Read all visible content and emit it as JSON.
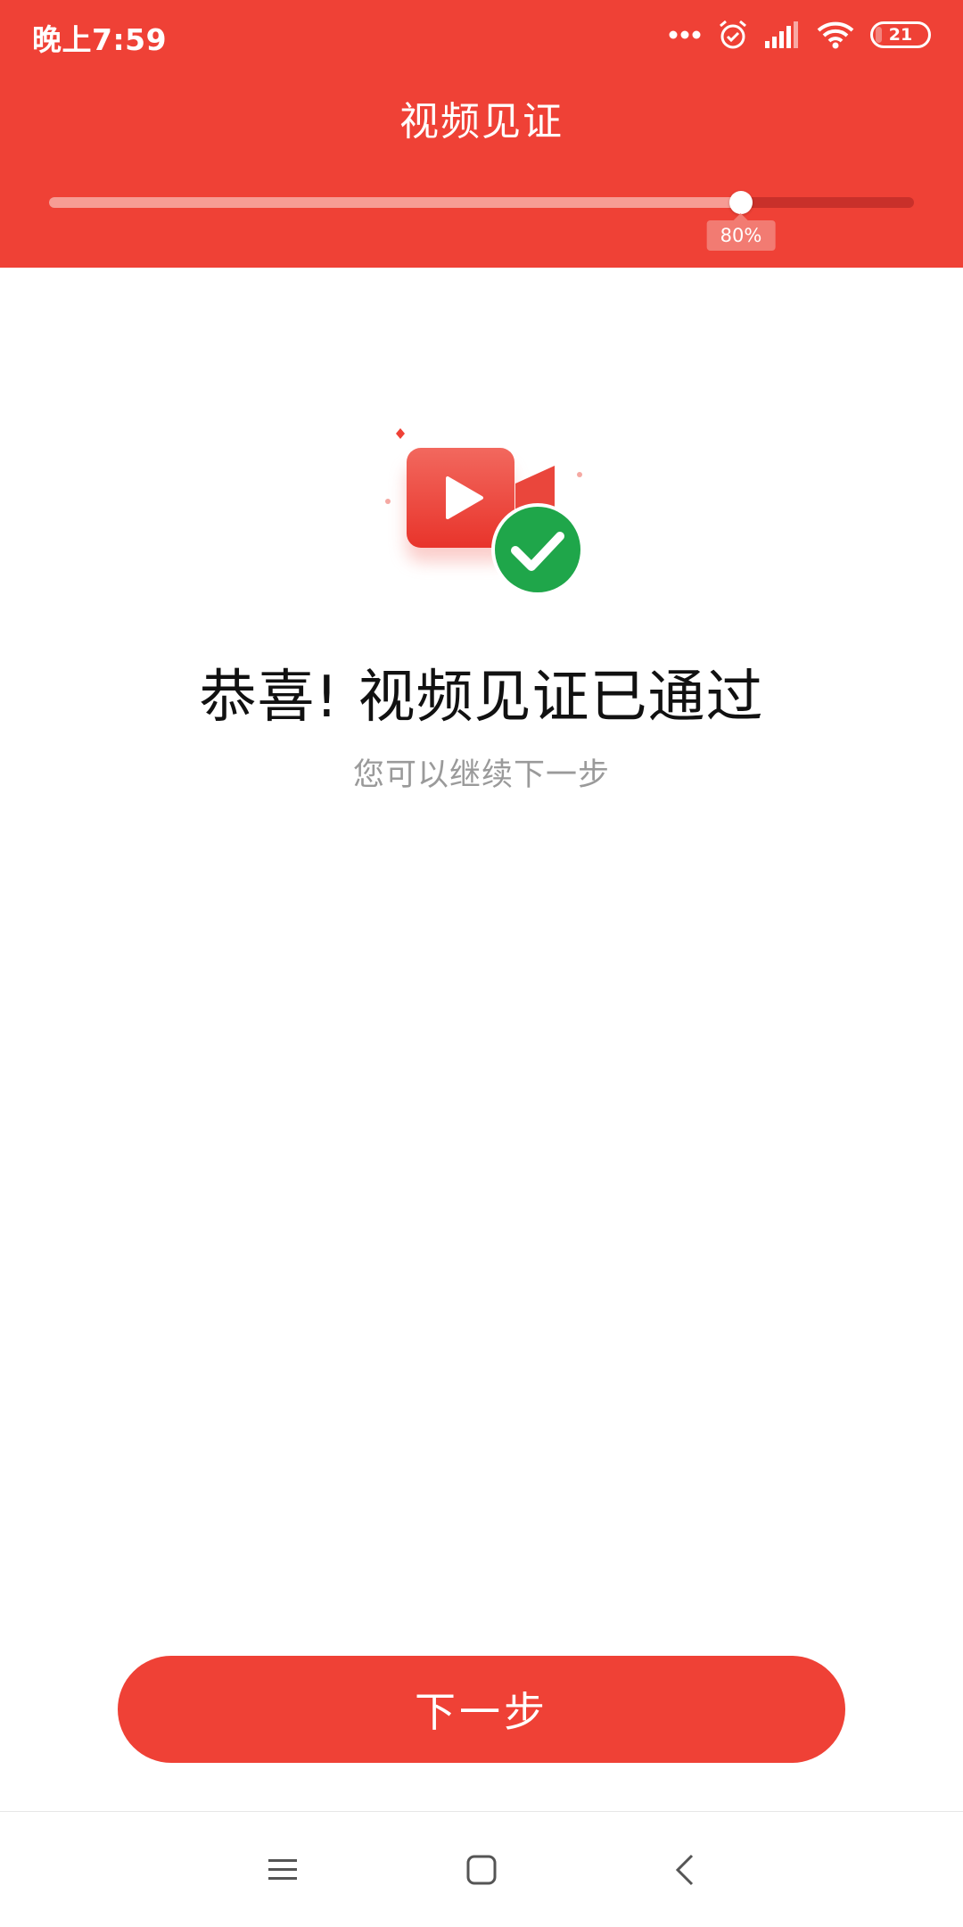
{
  "status_bar": {
    "time": "晚上7:59",
    "battery_level": "21",
    "icons": [
      "more-dots-icon",
      "alarm-icon",
      "signal-icon",
      "wifi-icon",
      "battery-icon"
    ]
  },
  "header": {
    "title": "视频见证",
    "background_color": "#ef4136"
  },
  "progress": {
    "value_percent": 80,
    "label": "80%"
  },
  "result": {
    "icon": "video-camera-check-icon",
    "title": "恭喜! 视频见证已通过",
    "subtitle": "您可以继续下一步"
  },
  "actions": {
    "next_label": "下一步"
  },
  "nav_bar": {
    "icons": [
      "menu-icon",
      "home-icon",
      "back-icon"
    ]
  }
}
